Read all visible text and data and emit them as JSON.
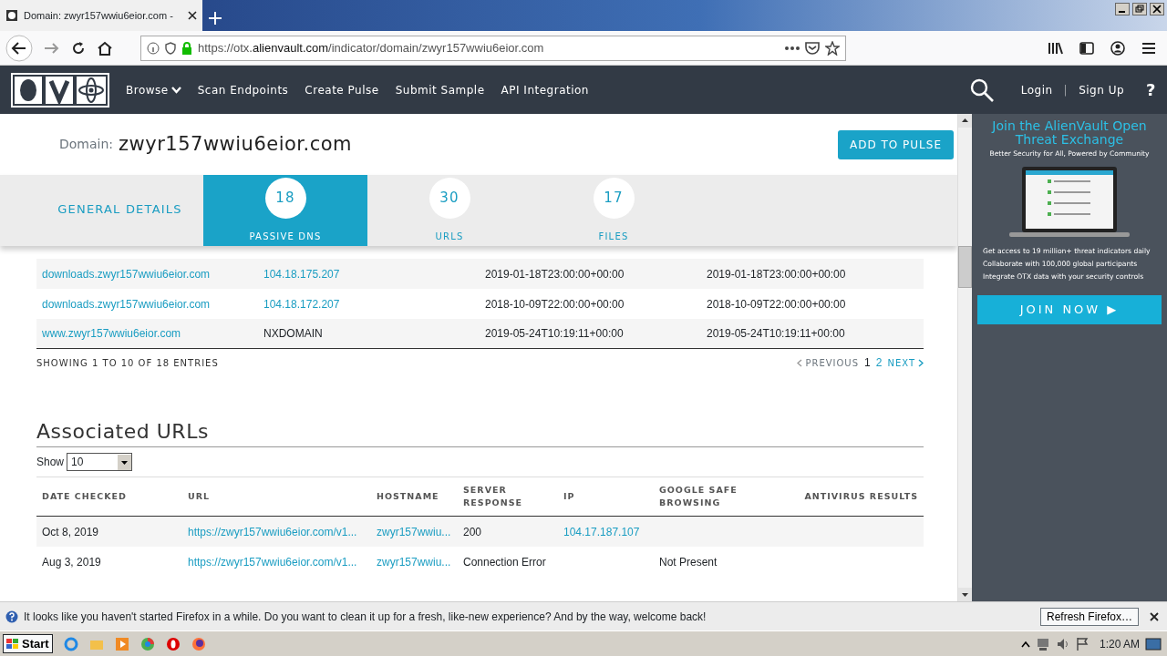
{
  "browser": {
    "tab_title": "Domain: zwyr157wwiu6eior.com -",
    "url": "https://otx.**alienvault.com**/indicator/domain/zwyr157wwiu6eior.com"
  },
  "nav": {
    "items": [
      {
        "label": "Browse",
        "kind": "dropdown"
      },
      {
        "label": "Scan Endpoints",
        "kind": "link"
      },
      {
        "label": "Create Pulse",
        "kind": "link"
      },
      {
        "label": "Submit Sample",
        "kind": "link"
      },
      {
        "label": "API Integration",
        "kind": "link"
      }
    ],
    "login": "Login",
    "separator": "|",
    "signup": "Sign Up",
    "help": "?"
  },
  "header": {
    "label": "Domain:",
    "value": "zwyr157wwiu6eior.com",
    "button": "ADD TO PULSE"
  },
  "tabs": [
    {
      "label": "GENERAL DETAILS",
      "selected": false
    },
    {
      "count": "18",
      "label": "PASSIVE DNS",
      "selected": true
    },
    {
      "count": "30",
      "label": "URLS",
      "selected": false
    },
    {
      "count": "17",
      "label": "FILES",
      "selected": false
    }
  ],
  "dns_table": {
    "rows": [
      {
        "hostname": "downloads.zwyr157wwiu6eior.com",
        "address": "104.18.175.207",
        "address_link": true,
        "first_seen": "2019-01-18T23:00:00+00:00",
        "last_seen": "2019-01-18T23:00:00+00:00"
      },
      {
        "hostname": "downloads.zwyr157wwiu6eior.com",
        "address": "104.18.172.207",
        "address_link": true,
        "first_seen": "2018-10-09T22:00:00+00:00",
        "last_seen": "2018-10-09T22:00:00+00:00"
      },
      {
        "hostname": "www.zwyr157wwiu6eior.com",
        "address": "NXDOMAIN",
        "address_link": false,
        "first_seen": "2019-05-24T10:19:11+00:00",
        "last_seen": "2019-05-24T10:19:11+00:00"
      }
    ],
    "info": "SHOWING 1 TO 10 OF 18 ENTRIES",
    "previous": "PREVIOUS",
    "pages": [
      {
        "label": "1",
        "selected": true
      },
      {
        "label": "2",
        "selected": false
      }
    ],
    "next": "NEXT"
  },
  "urls": {
    "title": "Associated URLs",
    "show_label": "Show",
    "show_value": "10",
    "columns": [
      "DATE CHECKED",
      "URL",
      "HOSTNAME",
      "SERVER RESPONSE",
      "IP",
      "GOOGLE SAFE BROWSING",
      "ANTIVIRUS RESULTS"
    ],
    "rows": [
      {
        "date": "Oct 8, 2019",
        "url": "https://zwyr157wwiu6eior.com/v1...",
        "hostname": "zwyr157wwiu...",
        "server_response": "200",
        "ip": "104.17.187.107"
      },
      {
        "date": "Aug 3, 2019",
        "url": "https://zwyr157wwiu6eior.com/v1...",
        "hostname": "zwyr157wwiu...",
        "server_response": "Connection Error",
        "google_safe_browsing": "Not Present"
      }
    ]
  },
  "ad": {
    "title": "Join the AlienVault Open Threat Exchange",
    "subtitle": "Better Security for All, Powered by Community",
    "bullets": [
      "Get access to 19 million+ threat indicators daily",
      "Collaborate with 100,000 global participants",
      "Integrate OTX data with your security controls"
    ],
    "button": "JOIN NOW ▶"
  },
  "notification": {
    "text": "It looks like you haven't started Firefox in a while. Do you want to clean it up for a fresh, like-new experience? And by the way, welcome back!",
    "button": "Refresh Firefox…"
  },
  "taskbar": {
    "start": "Start",
    "time": "1:20 AM"
  }
}
